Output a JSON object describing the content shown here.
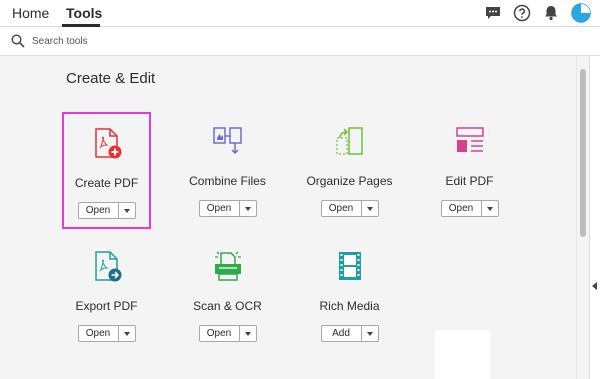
{
  "nav": {
    "home": "Home",
    "tools": "Tools"
  },
  "search": {
    "placeholder": "Search tools"
  },
  "section_title": "Create & Edit",
  "tools": [
    {
      "label": "Create PDF",
      "button": "Open",
      "icon": "create-pdf-icon"
    },
    {
      "label": "Combine Files",
      "button": "Open",
      "icon": "combine-files-icon"
    },
    {
      "label": "Organize Pages",
      "button": "Open",
      "icon": "organize-pages-icon"
    },
    {
      "label": "Edit PDF",
      "button": "Open",
      "icon": "edit-pdf-icon"
    },
    {
      "label": "Export PDF",
      "button": "Open",
      "icon": "export-pdf-icon"
    },
    {
      "label": "Scan & OCR",
      "button": "Open",
      "icon": "scan-ocr-icon"
    },
    {
      "label": "Rich Media",
      "button": "Add",
      "icon": "rich-media-icon"
    }
  ],
  "colors": {
    "selection": "#e63bd3",
    "create": "#e0343b",
    "combine": "#6e6ecf",
    "organize": "#6cbf3f",
    "edit": "#d6418c",
    "export": "#1ba29c",
    "scan": "#2fa84f",
    "media": "#1f9ea2"
  }
}
